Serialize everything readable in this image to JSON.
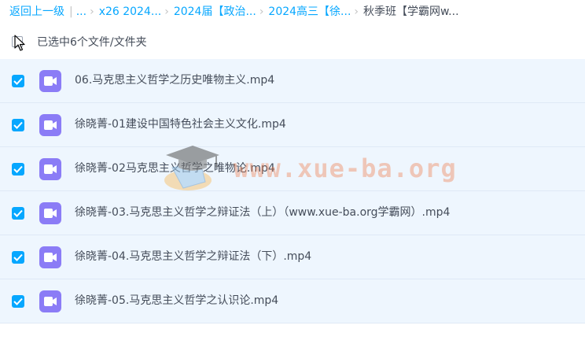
{
  "breadcrumb": {
    "back": "返回上一级",
    "ellipsis": "...",
    "items": [
      "x26 2024...",
      "2024届【政治...",
      "2024高三【徐..."
    ],
    "current": "秋季班【学霸网w..."
  },
  "toolbar": {
    "selected_text": "已选中6个文件/文件夹"
  },
  "files": [
    {
      "name": "06.马克思主义哲学之历史唯物主义.mp4"
    },
    {
      "name": "徐晓菁-01建设中国特色社会主义文化.mp4"
    },
    {
      "name": "徐晓菁-02马克思主义哲学之唯物论.mp4"
    },
    {
      "name": "徐晓菁-03.马克思主义哲学之辩证法（上）（www.xue-ba.org学霸网）.mp4"
    },
    {
      "name": "徐晓菁-04.马克思主义哲学之辩证法（下）.mp4"
    },
    {
      "name": "徐晓菁-05.马克思主义哲学之认识论.mp4"
    }
  ],
  "watermark": {
    "text": "www.xue-ba.org"
  },
  "colors": {
    "link": "#06a7ff",
    "checkbox": "#06a7ff",
    "video_icon": "#8b7cf6",
    "row_selected_bg": "#eef6fe"
  }
}
